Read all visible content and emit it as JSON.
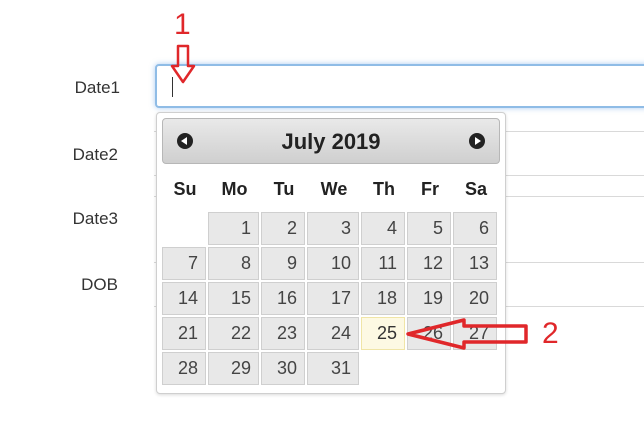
{
  "form": {
    "labels": {
      "date1": "Date1",
      "date2": "Date2",
      "date3": "Date3",
      "dob": "DOB"
    },
    "date1_value": ""
  },
  "datepicker": {
    "title": "July 2019",
    "weekdays": [
      "Su",
      "Mo",
      "Tu",
      "We",
      "Th",
      "Fr",
      "Sa"
    ],
    "weeks": [
      [
        "",
        "1",
        "2",
        "3",
        "4",
        "5",
        "6"
      ],
      [
        "7",
        "8",
        "9",
        "10",
        "11",
        "12",
        "13"
      ],
      [
        "14",
        "15",
        "16",
        "17",
        "18",
        "19",
        "20"
      ],
      [
        "21",
        "22",
        "23",
        "24",
        "25",
        "26",
        "27"
      ],
      [
        "28",
        "29",
        "30",
        "31",
        "",
        "",
        ""
      ]
    ],
    "highlighted_day": "25"
  },
  "annotations": {
    "marker_1": "1",
    "marker_2": "2",
    "color": "#e0272a"
  }
}
